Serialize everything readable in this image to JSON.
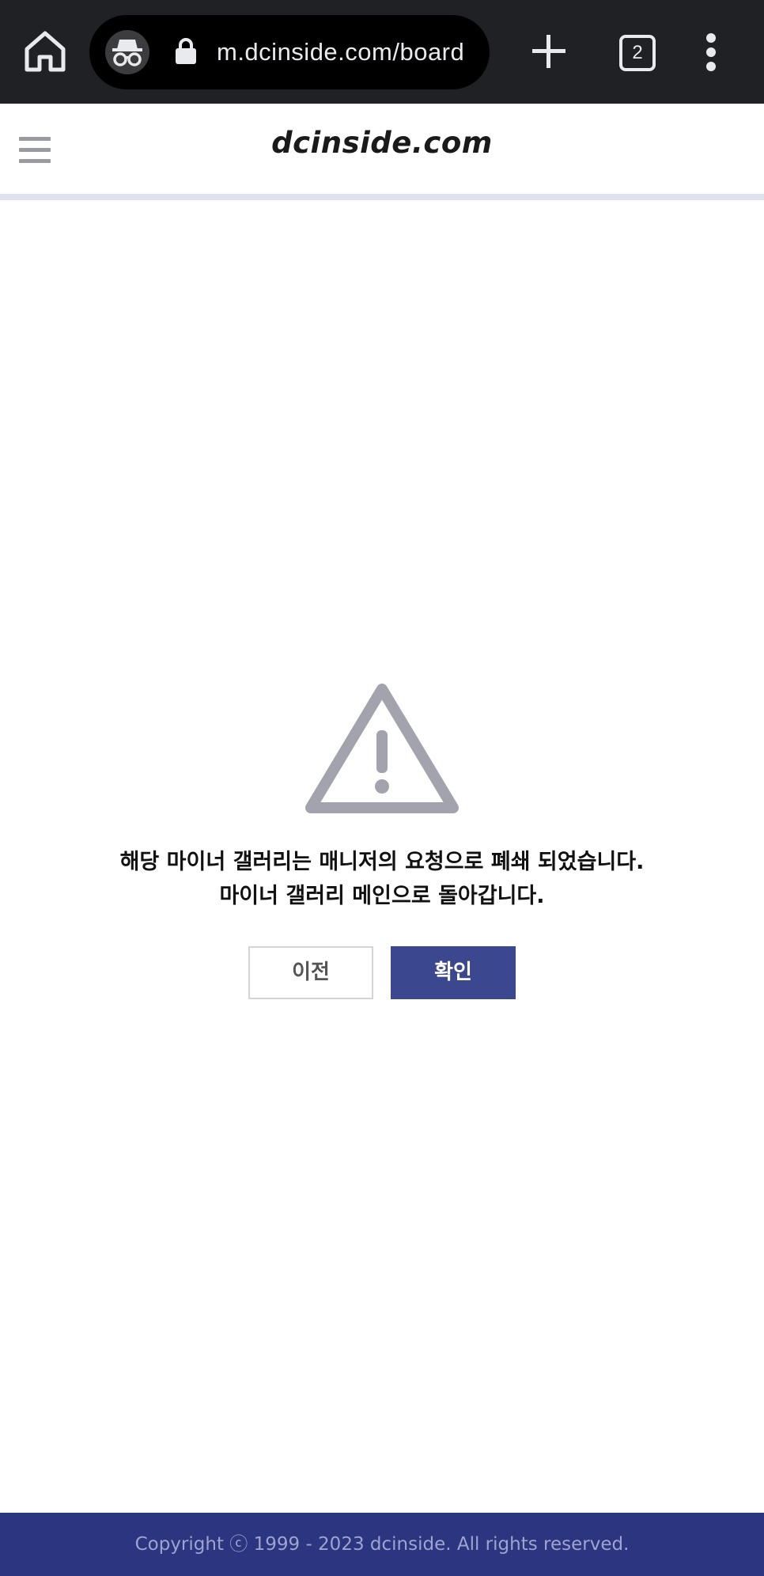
{
  "browser": {
    "url": "m.dcinside.com/board",
    "tab_count": "2",
    "icons": [
      "home-icon",
      "incognito-icon",
      "lock-icon",
      "plus-icon",
      "tabs-icon",
      "more-vert-icon"
    ]
  },
  "header": {
    "logo": "dcinside.com",
    "menu_icon": "hamburger-icon"
  },
  "notice": {
    "icon": "warning-triangle-icon",
    "line1": "해당 마이너 갤러리는 매니저의 요청으로 폐쇄 되었습니다.",
    "line2": "마이너 갤러리 메인으로 돌아갑니다."
  },
  "buttons": {
    "prev_label": "이전",
    "ok_label": "확인"
  },
  "footer": {
    "copyright": "Copyright ⓒ 1999 - 2023 dcinside. All rights reserved."
  },
  "colors": {
    "browser_bar": "#202124",
    "accent": "#3b4890",
    "footer_bg": "#2c3580",
    "icon_gray": "#a2a3ad"
  }
}
